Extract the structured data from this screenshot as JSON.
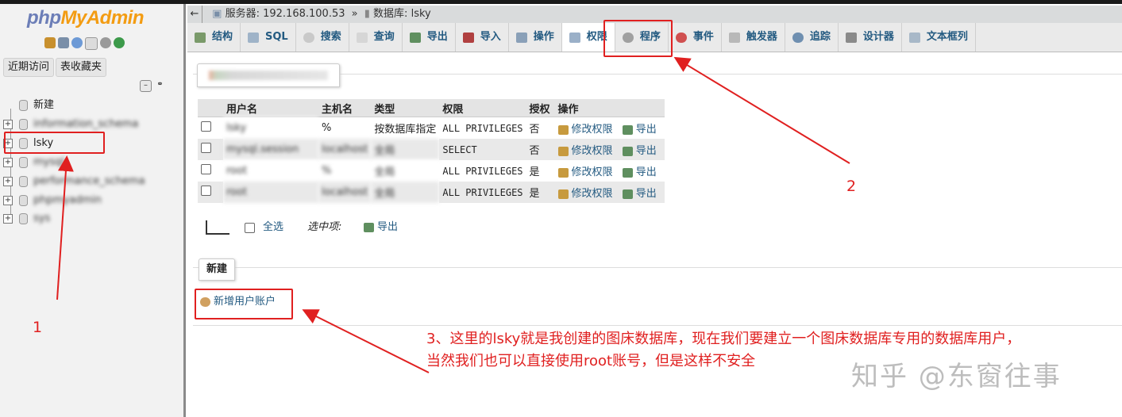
{
  "logo": {
    "php": "php",
    "myadmin": "MyAdmin"
  },
  "sidebar": {
    "recent_btn": "近期访问",
    "fav_btn": "表收藏夹",
    "new_item": "新建",
    "databases": [
      "information_schema",
      "lsky",
      "mysql",
      "performance_schema",
      "phpmyadmin",
      "sys"
    ]
  },
  "breadcrumb": {
    "server_label": "服务器:",
    "server": "192.168.100.53",
    "sep": "»",
    "db_label": "数据库:",
    "db": "lsky"
  },
  "tabs": [
    "结构",
    "SQL",
    "搜索",
    "查询",
    "导出",
    "导入",
    "操作",
    "权限",
    "程序",
    "事件",
    "触发器",
    "追踪",
    "设计器",
    "文本框列"
  ],
  "active_tab": "权限",
  "users_table": {
    "headers": [
      "用户名",
      "主机名",
      "类型",
      "权限",
      "授权",
      "操作"
    ],
    "rows": [
      {
        "user": "lsky",
        "host": "%",
        "type": "按数据库指定",
        "priv": "ALL PRIVILEGES",
        "grant": "否"
      },
      {
        "user": "mysql.session",
        "host": "localhost",
        "type": "全局",
        "priv": "SELECT",
        "grant": "否"
      },
      {
        "user": "root",
        "host": "%",
        "type": "全局",
        "priv": "ALL PRIVILEGES",
        "grant": "是"
      },
      {
        "user": "root",
        "host": "localhost",
        "type": "全局",
        "priv": "ALL PRIVILEGES",
        "grant": "是"
      }
    ],
    "edit_label": "修改权限",
    "export_label": "导出"
  },
  "bulk": {
    "select_all": "全选",
    "with_selected": "选中项:",
    "export": "导出"
  },
  "new_section": {
    "legend": "新建",
    "add_user": "新增用户账户"
  },
  "annotations": {
    "n1": "1",
    "n2": "2",
    "note_line1": "3、这里的lsky就是我创建的图床数据库，现在我们要建立一个图床数据库专用的数据库用户，",
    "note_line2": "当然我们也可以直接使用root账号，但是这样不安全"
  },
  "watermark": "知乎 @东窗往事",
  "colors": {
    "accent": "#235a81",
    "annotation": "#e02020",
    "logo_php": "#6c7eb7",
    "logo_myadmin": "#f39c12"
  }
}
